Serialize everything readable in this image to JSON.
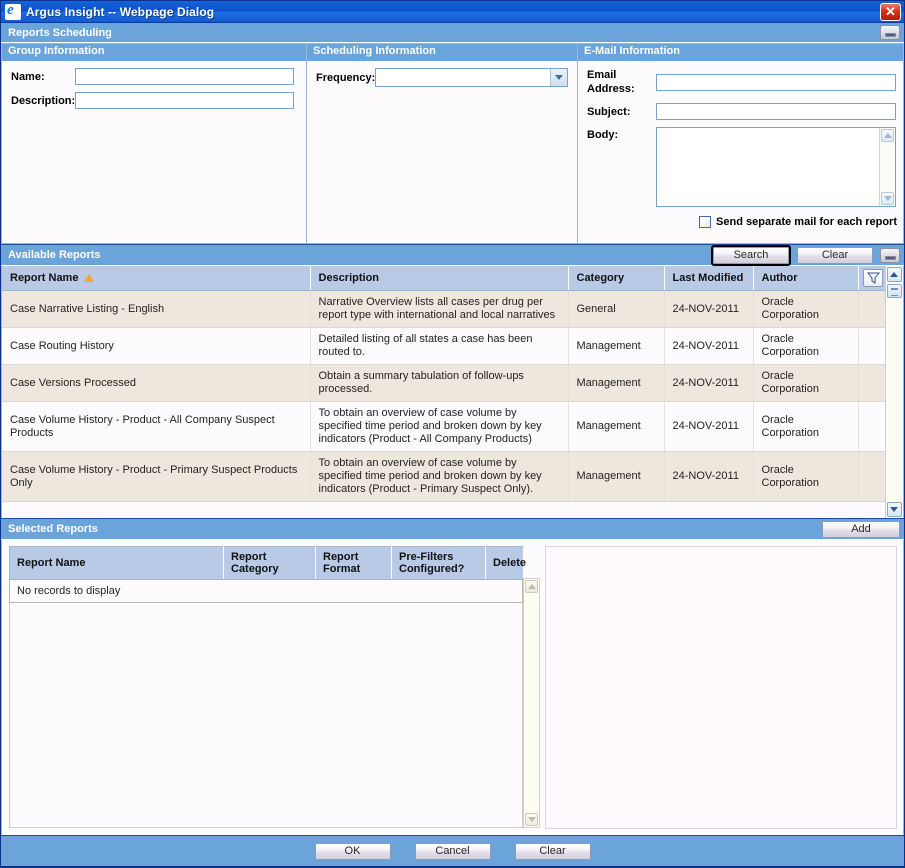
{
  "window": {
    "title": "Argus Insight -- Webpage Dialog",
    "ie_icon": "internet-explorer-icon",
    "close_label": "✕"
  },
  "page": {
    "band_title": "Reports Scheduling",
    "export_icon": "export-icon"
  },
  "group_information": {
    "title": "Group Information",
    "name_label": "Name:",
    "name_value": "",
    "description_label": "Description:",
    "description_value": ""
  },
  "scheduling_information": {
    "title": "Scheduling Information",
    "frequency_label": "Frequency:",
    "frequency_value": "",
    "frequency_options": []
  },
  "email_information": {
    "title": "E-Mail Information",
    "email_address_label": "Email Address:",
    "email_address_value": "",
    "subject_label": "Subject:",
    "subject_value": "",
    "body_label": "Body:",
    "body_value": "",
    "send_separate_label": "Send separate mail for each report",
    "send_separate_checked": false
  },
  "available_reports": {
    "title": "Available Reports",
    "search_label": "Search",
    "clear_label": "Clear",
    "export_icon": "export-icon",
    "filter_icon": "filter-icon",
    "sort_column": "Report Name",
    "sort_direction": "ascending",
    "columns": [
      "Report Name",
      "Description",
      "Category",
      "Last Modified",
      "Author"
    ],
    "rows": [
      {
        "name": "Case Narrative Listing - English",
        "description": "Narrative Overview lists all cases per drug per report type with international and local narratives",
        "category": "General",
        "last_modified": "24-NOV-2011",
        "author": "Oracle Corporation"
      },
      {
        "name": "Case Routing History",
        "description": "Detailed listing of all states a case has been routed to.",
        "category": "Management",
        "last_modified": "24-NOV-2011",
        "author": "Oracle Corporation"
      },
      {
        "name": "Case Versions Processed",
        "description": "Obtain a summary tabulation of follow-ups processed.",
        "category": "Management",
        "last_modified": "24-NOV-2011",
        "author": "Oracle Corporation"
      },
      {
        "name": "Case Volume History - Product - All Company Suspect Products",
        "description": "To obtain an overview of case volume by specified time period and broken down by key indicators (Product - All Company Products)",
        "category": "Management",
        "last_modified": "24-NOV-2011",
        "author": "Oracle Corporation"
      },
      {
        "name": "Case Volume History - Product - Primary Suspect Products Only",
        "description": "To obtain an overview of case volume by specified time period and broken down by key indicators (Product - Primary Suspect Only).",
        "category": "Management",
        "last_modified": "24-NOV-2011",
        "author": "Oracle Corporation"
      }
    ]
  },
  "selected_reports": {
    "title": "Selected Reports",
    "add_label": "Add",
    "columns": [
      "Report Name",
      "Report Category",
      "Report Format",
      "Pre-Filters Configured?",
      "Delete"
    ],
    "empty_message": "No records to display"
  },
  "footer": {
    "ok_label": "OK",
    "cancel_label": "Cancel",
    "clear_label": "Clear"
  },
  "colors": {
    "title_bar": "#0a4fcb",
    "band": "#6ba4da",
    "grid_header": "#b8cae6",
    "row_alt": "#eee7dd",
    "sort_arrow": "#f5a623",
    "close_button": "#d8301c"
  }
}
